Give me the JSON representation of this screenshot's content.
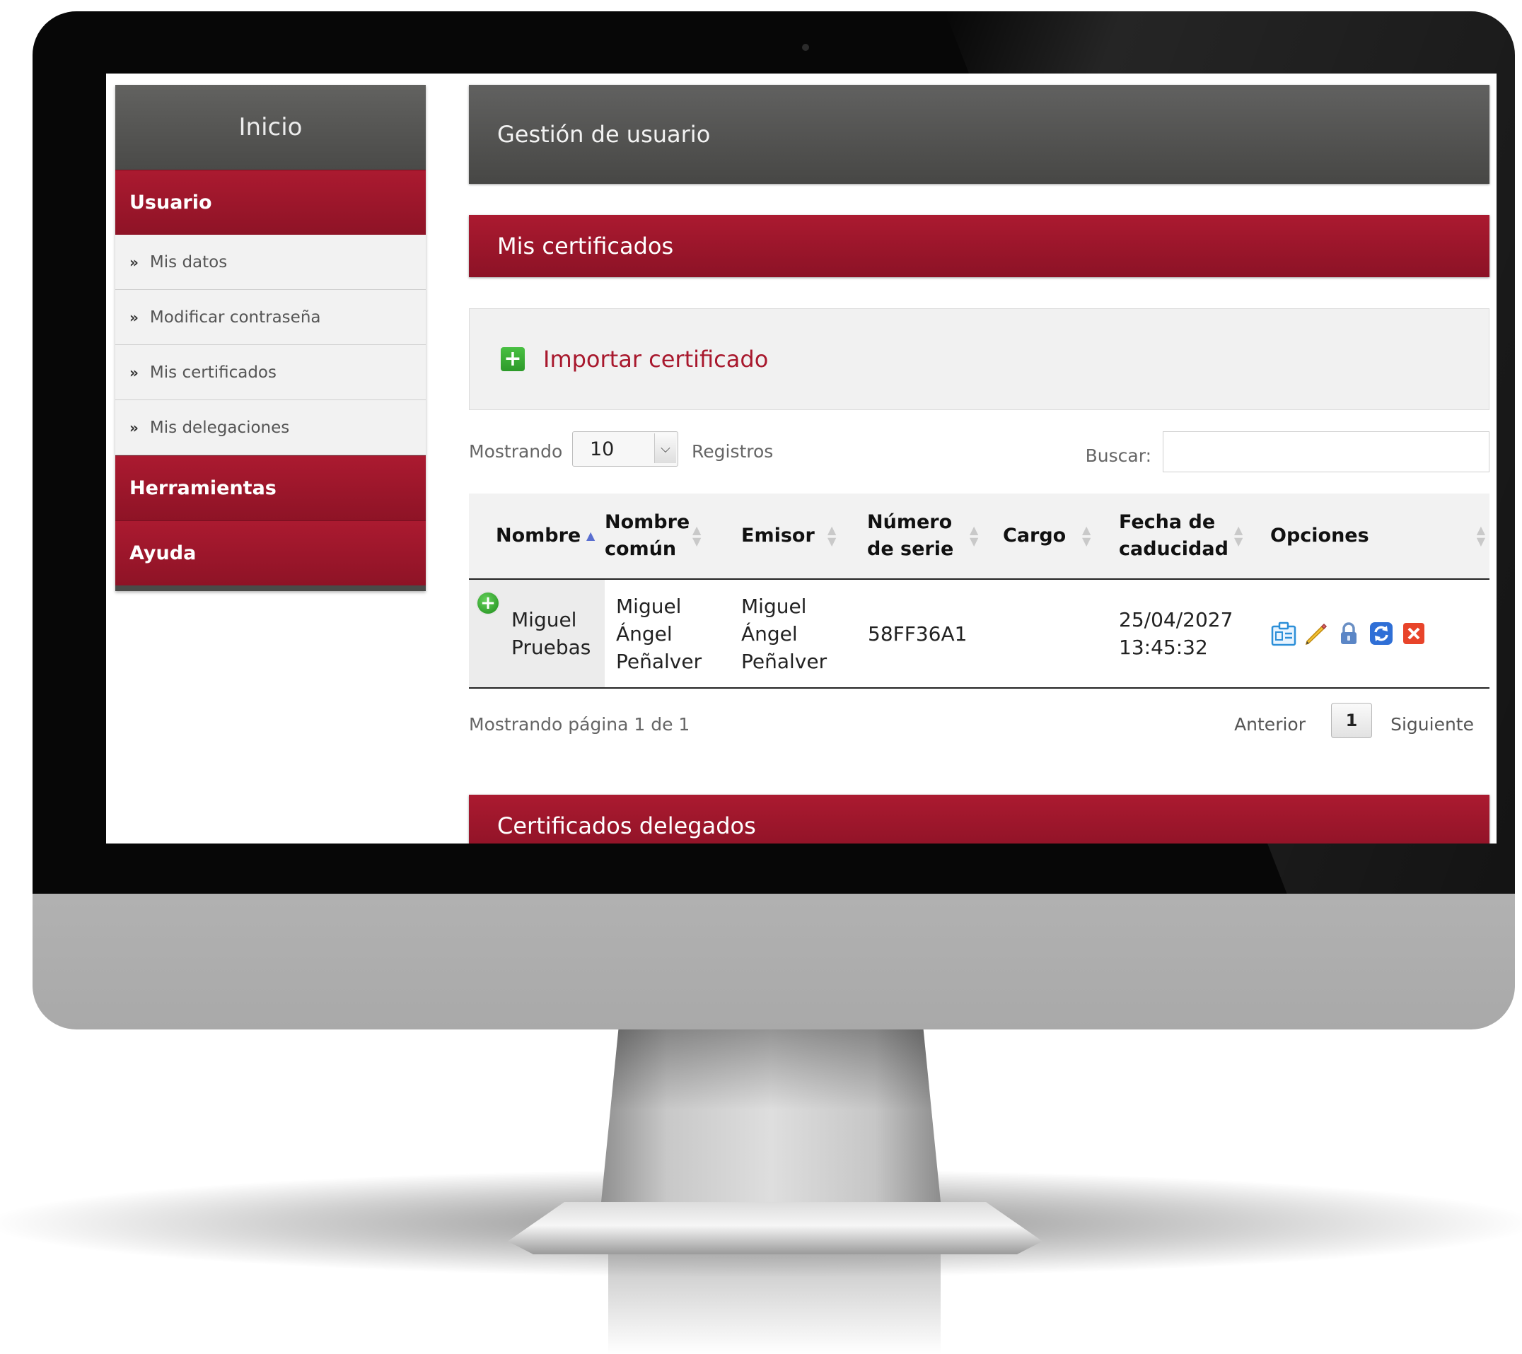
{
  "sidebar": {
    "header": "Inicio",
    "sections": {
      "usuario": "Usuario",
      "herramientas": "Herramientas",
      "ayuda": "Ayuda"
    },
    "submenu": [
      {
        "label": "Mis datos"
      },
      {
        "label": "Modificar contraseña"
      },
      {
        "label": "Mis certificados"
      },
      {
        "label": "Mis delegaciones"
      }
    ],
    "chevron": "»"
  },
  "main": {
    "page_title": "Gestión de usuario",
    "section_title": "Mis certificados",
    "import_label": "Importar certificado",
    "length_prefix": "Mostrando",
    "length_value": "10",
    "length_suffix": "Registros",
    "search_label": "Buscar:",
    "search_value": "",
    "table": {
      "headers": {
        "nombre": "Nombre",
        "comun_1": "Nombre",
        "comun_2": "común",
        "emisor": "Emisor",
        "serie_1": "Número",
        "serie_2": "de serie",
        "cargo": "Cargo",
        "fecha_1": "Fecha de",
        "fecha_2": "caducidad",
        "opciones": "Opciones"
      },
      "rows": [
        {
          "nombre_1": "Miguel",
          "nombre_2": "Pruebas",
          "comun_1": "Miguel",
          "comun_2": "Ángel",
          "comun_3": "Peñalver",
          "emisor_1": "Miguel",
          "emisor_2": "Ángel",
          "emisor_3": "Peñalver",
          "serie": "58FF36A1",
          "cargo": "",
          "fecha_1": "25/04/2027",
          "fecha_2": "13:45:32",
          "options": [
            "id-card-icon",
            "pencil-edit-icon",
            "lock-icon",
            "refresh-icon",
            "delete-x-icon"
          ]
        }
      ]
    },
    "pagination": {
      "info": "Mostrando página 1 de 1",
      "previous": "Anterior",
      "current": "1",
      "next": "Siguiente"
    },
    "delegated_title": "Certificados delegados"
  },
  "colors": {
    "brand_red": "#a01a2e",
    "dark_header": "#545452",
    "link_red": "#a8182d",
    "add_green": "#3aad35"
  },
  "icons": {
    "add": "plus-square-icon",
    "expand": "plus-circle-icon",
    "sort_asc": "sort-asc-icon",
    "sort_both": "sort-both-icon"
  }
}
